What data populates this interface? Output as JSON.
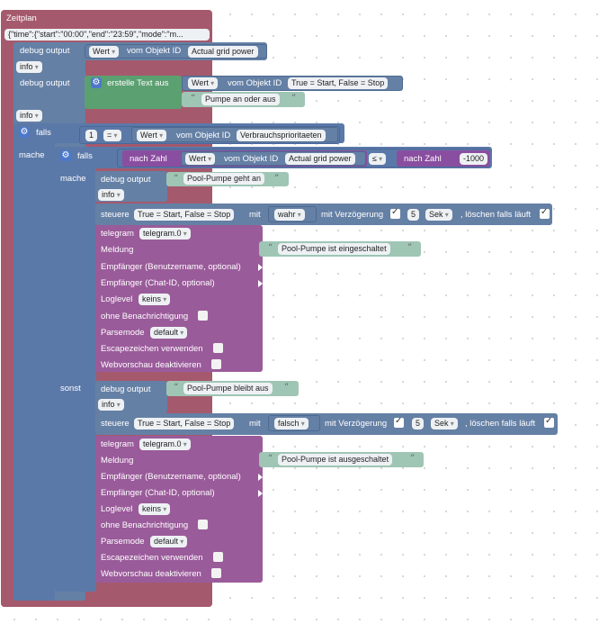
{
  "colors": {
    "event": "#a5596d",
    "system": "#6580a5",
    "logic": "#5b79a8",
    "text": "#9fc5b5",
    "textgreen": "#5ba071",
    "telegram": "#9a5b9a",
    "field": "#eef1f4",
    "math": "#8a4ea0"
  },
  "schedule": {
    "title": "Zeitplan",
    "spec": "{\"time\":{\"start\":\"00:00\",\"end\":\"23:59\",\"mode\":\"m..."
  },
  "debug1": {
    "label": "debug output",
    "value_type": "Wert",
    "of_object": "vom Objekt ID",
    "object": "Actual grid power",
    "level": "info"
  },
  "debug2": {
    "label": "debug output",
    "create_text": "erstelle Text aus",
    "value_type": "Wert",
    "of_object": "vom Objekt ID",
    "object": "True = Start, False = Stop",
    "text": "Pumpe an oder aus",
    "level": "info"
  },
  "if1": {
    "label": "falls",
    "num": "1",
    "op": "=",
    "value_type": "Wert",
    "of_object": "vom Objekt ID",
    "object": "Verbrauchsprioritaeten",
    "do_label": "mache"
  },
  "if2": {
    "label": "falls",
    "to_number": "nach Zahl",
    "value_type": "Wert",
    "of_object": "vom Objekt ID",
    "object": "Actual grid power",
    "op": "≤",
    "to_number2": "nach Zahl",
    "threshold": "-1000",
    "do_label": "mache",
    "else_label": "sonst"
  },
  "then": {
    "debug_label": "debug output",
    "debug_text": "Pool-Pumpe geht an",
    "debug_level": "info",
    "control": "steuere",
    "control_object": "True = Start, False = Stop",
    "with": "mit",
    "value": "wahr",
    "delay_label": "mit Verzögerung",
    "delay": "5",
    "unit": "Sek",
    "clear_label": ", löschen falls läuft",
    "telegram": {
      "label": "telegram",
      "instance": "telegram.0",
      "message_label": "Meldung",
      "message": "Pool-Pumpe ist eingeschaltet",
      "recipient_user": "Empfänger (Benutzername, optional)",
      "recipient_chat": "Empfänger (Chat-ID, optional)",
      "loglevel_label": "Loglevel",
      "loglevel": "keins",
      "silent": "ohne Benachrichtigung",
      "parse_label": "Parsemode",
      "parse": "default",
      "escape": "Escapezeichen verwenden",
      "preview": "Webvorschau deaktivieren"
    }
  },
  "else": {
    "debug_label": "debug output",
    "debug_text": "Pool-Pumpe bleibt aus",
    "debug_level": "info",
    "control": "steuere",
    "control_object": "True = Start, False = Stop",
    "with": "mit",
    "value": "falsch",
    "delay_label": "mit Verzögerung",
    "delay": "5",
    "unit": "Sek",
    "clear_label": ", löschen falls läuft",
    "telegram": {
      "label": "telegram",
      "instance": "telegram.0",
      "message_label": "Meldung",
      "message": "Pool-Pumpe ist ausgeschaltet",
      "recipient_user": "Empfänger (Benutzername, optional)",
      "recipient_chat": "Empfänger (Chat-ID, optional)",
      "loglevel_label": "Loglevel",
      "loglevel": "keins",
      "silent": "ohne Benachrichtigung",
      "parse_label": "Parsemode",
      "parse": "default",
      "escape": "Escapezeichen verwenden",
      "preview": "Webvorschau deaktivieren"
    }
  }
}
